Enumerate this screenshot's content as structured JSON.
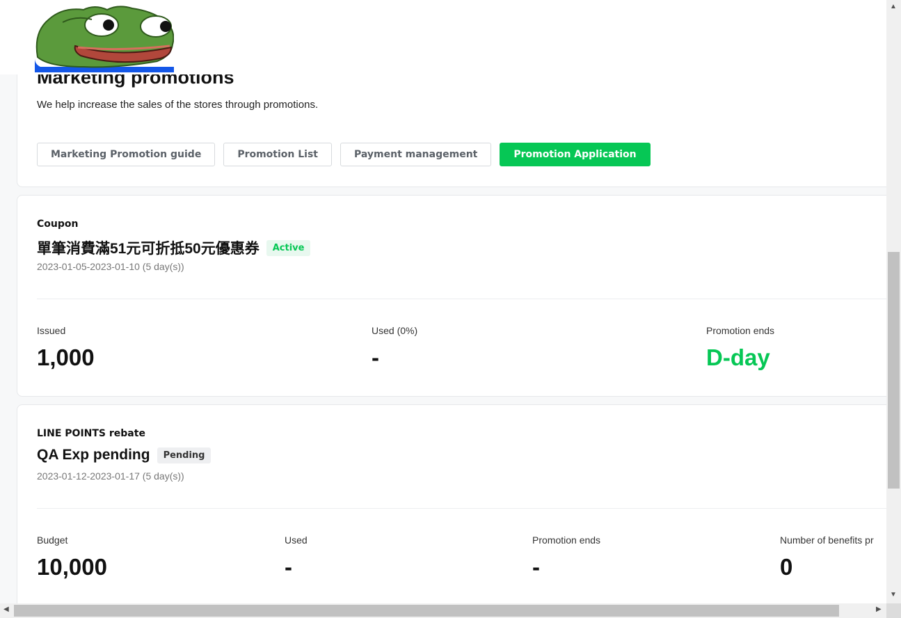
{
  "header": {
    "title": "Marketing promotions",
    "subtitle": "We help increase the sales of the stores through promotions.",
    "tabs": [
      {
        "label": "Marketing Promotion guide"
      },
      {
        "label": "Promotion List"
      },
      {
        "label": "Payment management"
      },
      {
        "label": "Promotion Application"
      }
    ]
  },
  "coupon": {
    "type": "Coupon",
    "title": "單筆消費滿51元可折抵50元優惠券",
    "status": "Active",
    "dates": "2023-01-05-2023-01-10 (5 day(s))",
    "stats": [
      {
        "label": "Issued",
        "value": "1,000"
      },
      {
        "label": "Used (0%)",
        "value": "-"
      },
      {
        "label": "Promotion ends",
        "value": "D-day"
      }
    ]
  },
  "points": {
    "type": "LINE POINTS rebate",
    "title": "QA Exp pending",
    "status": "Pending",
    "dates": "2023-01-12-2023-01-17 (5 day(s))",
    "stats": [
      {
        "label": "Budget",
        "value": "10,000"
      },
      {
        "label": "Used",
        "value": "-"
      },
      {
        "label": "Promotion ends",
        "value": "-"
      },
      {
        "label": "Number of benefits pr",
        "value": "0"
      }
    ]
  },
  "colors": {
    "accent": "#06c755",
    "badge_active_bg": "#e8f8ef",
    "badge_pending_bg": "#eeeff1"
  },
  "icons": {
    "sticker": "pepe-frog-sticker",
    "scroll_up": "triangle-up",
    "scroll_down": "triangle-down",
    "scroll_left": "triangle-left",
    "scroll_right": "triangle-right"
  }
}
